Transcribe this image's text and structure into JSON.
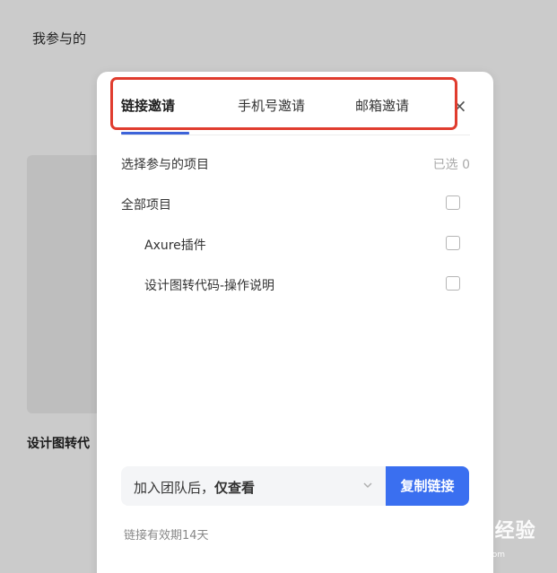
{
  "background": {
    "title": "我参与的",
    "card_label": "设计图转代"
  },
  "modal": {
    "tabs": [
      {
        "label": "链接邀请",
        "active": true
      },
      {
        "label": "手机号邀请",
        "active": false
      },
      {
        "label": "邮箱邀请",
        "active": false
      }
    ],
    "close_icon": "close-icon",
    "select_projects_label": "选择参与的项目",
    "selected_count": "已选 0",
    "projects": [
      {
        "label": "全部项目",
        "checked": false
      },
      {
        "label": "Axure插件",
        "checked": false
      },
      {
        "label": "设计图转代码-操作说明",
        "checked": false
      }
    ],
    "permission_select": {
      "prefix": "加入团队后，",
      "value": "仅查看"
    },
    "copy_button_label": "复制链接",
    "validity_text": "链接有效期14天"
  },
  "watermark": {
    "text": "Baidu经验",
    "sub": "jingyan.baidu.com"
  },
  "colors": {
    "accent": "#3a6ff0",
    "tab_underline": "#3d63d9",
    "highlight": "#e03c2e",
    "overlay": "#cbcbcb"
  }
}
